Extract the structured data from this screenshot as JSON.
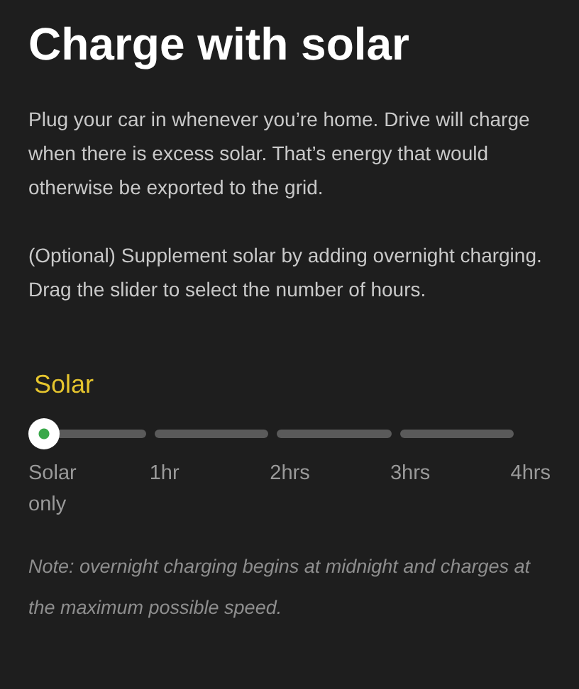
{
  "title": "Charge with solar",
  "paragraphs": [
    "Plug your car in whenever you’re home. Drive will charge when there is excess solar. That’s energy that would otherwise be exported to the grid.",
    "(Optional) Supplement solar by adding overnight charging. Drag the slider to select the number of hours."
  ],
  "slider": {
    "label": "Solar",
    "level": 0,
    "ticks": [
      "Solar only",
      "1hr",
      "2hrs",
      "3hrs",
      "4hrs"
    ]
  },
  "note": "Note: overnight charging begins at midnight and charges at the maximum possible speed."
}
